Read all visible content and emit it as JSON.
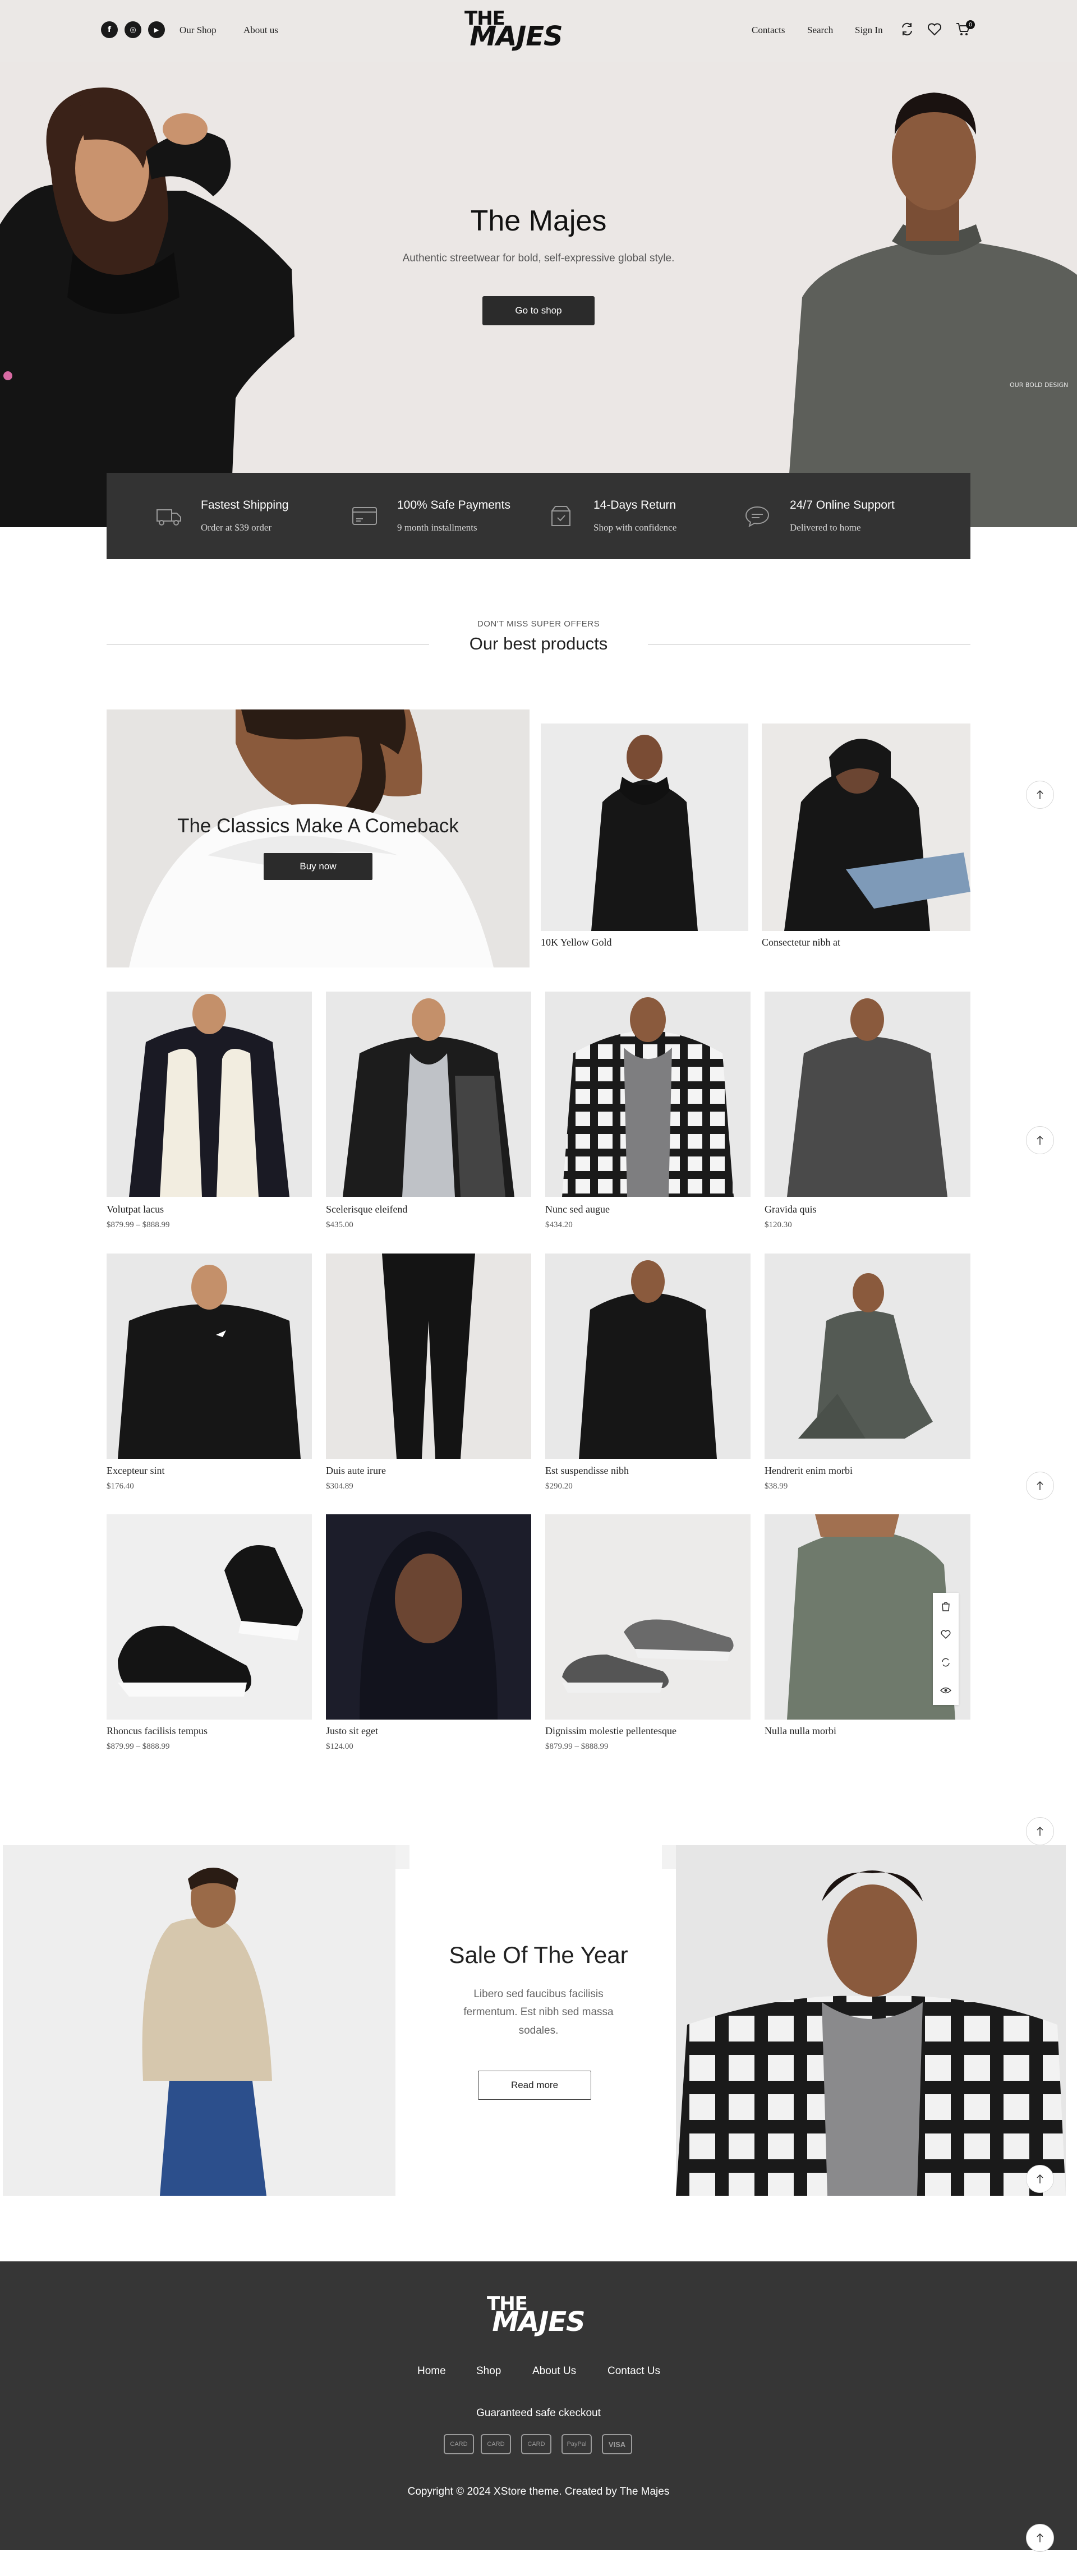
{
  "header": {
    "social": [
      {
        "icon": "facebook-icon",
        "glyph": "f"
      },
      {
        "icon": "instagram-icon",
        "glyph": "◎"
      },
      {
        "icon": "youtube-icon",
        "glyph": "▶"
      }
    ],
    "nav_left": [
      "Our Shop",
      "About us"
    ],
    "logo_line1": "THE",
    "logo_line2": "MAJES",
    "nav_right": [
      "Contacts",
      "Search",
      "Sign In"
    ],
    "cart_count": "0"
  },
  "hero": {
    "title": "The Majes",
    "subtitle": "Authentic streetwear for bold, self-expressive global style.",
    "button": "Go to shop"
  },
  "features": [
    {
      "icon": "truck-icon",
      "title": "Fastest Shipping",
      "subtitle": "Order at $39 order"
    },
    {
      "icon": "credit-card-icon",
      "title": "100% Safe Payments",
      "subtitle": "9 month installments"
    },
    {
      "icon": "return-box-icon",
      "title": "14-Days Return",
      "subtitle": "Shop with confidence"
    },
    {
      "icon": "chat-support-icon",
      "title": "24/7 Online Support",
      "subtitle": "Delivered to home"
    }
  ],
  "offers": {
    "eyebrow": "DON'T MISS SUPER OFFERS",
    "title": "Our best products"
  },
  "banner": {
    "title": "The Classics Make A Comeback",
    "button": "Buy now"
  },
  "featured_products": [
    {
      "name": "10K Yellow Gold"
    },
    {
      "name": "Consectetur nibh at"
    }
  ],
  "products": [
    {
      "name": "Volutpat lacus",
      "price": "$879.99 – $888.99"
    },
    {
      "name": "Scelerisque eleifend",
      "price": "$435.00"
    },
    {
      "name": "Nunc sed augue",
      "price": "$434.20"
    },
    {
      "name": "Gravida quis",
      "price": "$120.30"
    },
    {
      "name": "Excepteur sint",
      "price": "$176.40"
    },
    {
      "name": "Duis aute irure",
      "price": "$304.89"
    },
    {
      "name": "Est suspendisse nibh",
      "price": "$290.20"
    },
    {
      "name": "Hendrerit enim morbi",
      "price": "$38.99"
    },
    {
      "name": "Rhoncus facilisis tempus",
      "price": "$879.99 – $888.99"
    },
    {
      "name": "Justo sit eget",
      "price": "$124.00"
    },
    {
      "name": "Dignissim molestie pellentesque",
      "price": "$879.99 – $888.99"
    },
    {
      "name": "Nulla nulla morbi",
      "price": ""
    }
  ],
  "product_actions": [
    "shopping-bag-icon",
    "heart-icon",
    "refresh-compare-icon",
    "eye-icon"
  ],
  "sale": {
    "title": "Sale Of The Year",
    "text": "Libero sed faucibus facilisis fermentum. Est nibh sed massa sodales.",
    "button": "Read more"
  },
  "footer": {
    "logo_line1": "THE",
    "logo_line2": "MAJES",
    "links": [
      "Home",
      "Shop",
      "About Us",
      "Contact Us"
    ],
    "checkout_text": "Guaranteed safe ckeckout",
    "payment_cards": [
      "CARD",
      "CARD",
      "CARD",
      "PayPal",
      "VISA"
    ],
    "copyright": "Copyright © 2024 XStore theme. Created by The Majes"
  },
  "colors": {
    "hero_bg": "#ebe7e5",
    "dark": "#333333",
    "footer_bg": "#363636"
  }
}
